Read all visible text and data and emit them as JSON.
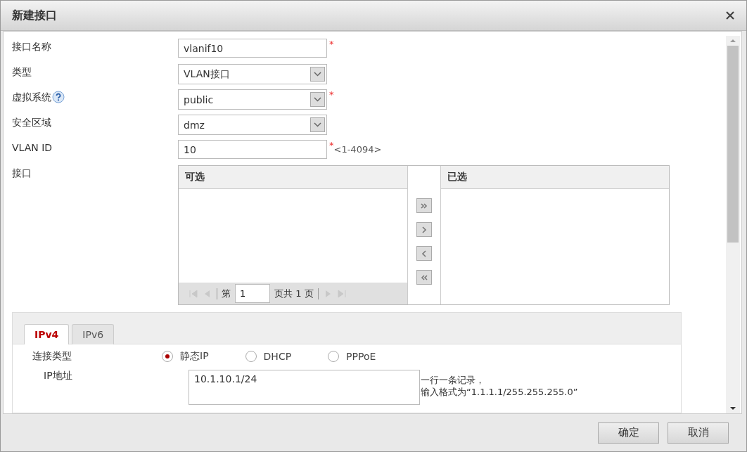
{
  "dialog": {
    "title": "新建接口"
  },
  "fields": [
    {
      "label": "接口名称",
      "kind": "text",
      "value": "vlanif10",
      "required_mark": "*"
    },
    {
      "label": "类型",
      "kind": "select",
      "value": "VLAN接口"
    },
    {
      "label": "虚拟系统",
      "kind": "select",
      "value": "public",
      "required_mark": "*",
      "help": true
    },
    {
      "label": "安全区域",
      "kind": "select",
      "value": "dmz"
    },
    {
      "label": "VLAN ID",
      "kind": "text",
      "value": "10",
      "required_mark": "*",
      "hint": "<1-4094>"
    }
  ],
  "interface_picker": {
    "label": "接口",
    "available": {
      "header": "可选",
      "pager": {
        "page_prefix": "第",
        "page": "1",
        "page_suffix": "页共 1 页"
      }
    },
    "chosen": {
      "header": "已选"
    }
  },
  "address_tabs": [
    {
      "label": "IPv4",
      "selected": true
    },
    {
      "label": "IPv6",
      "selected": false
    }
  ],
  "connection_type": {
    "label": "连接类型",
    "options": [
      {
        "label": "静态IP",
        "selected": true
      },
      {
        "label": "DHCP",
        "selected": false
      },
      {
        "label": "PPPoE",
        "selected": false
      }
    ]
  },
  "ip_address": {
    "label": "IP地址",
    "value": "10.1.10.1/24",
    "hint_lines": [
      "一行一条记录，",
      "输入格式为“1.1.1.1/255.255.255.0”"
    ]
  },
  "buttons": [
    "确定",
    "取消"
  ]
}
